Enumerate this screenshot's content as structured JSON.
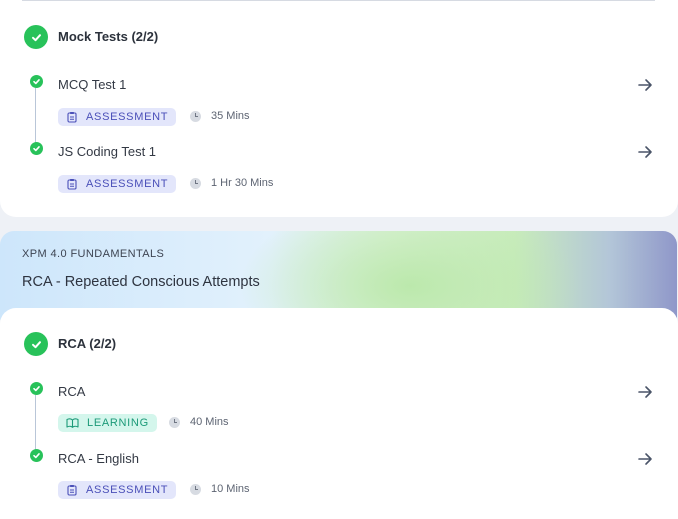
{
  "colors": {
    "success": "#28c25a",
    "assessment_badge_bg": "#e3e6fb",
    "assessment_badge_text": "#4a4fb8",
    "learning_badge_bg": "#d4f6ec",
    "learning_badge_text": "#1c9a78"
  },
  "mock_tests": {
    "title": "Mock Tests (2/2)",
    "items": [
      {
        "title": "MCQ Test 1",
        "badge": "ASSESSMENT",
        "badge_icon": "clipboard-icon",
        "duration": "35 Mins",
        "status": "completed"
      },
      {
        "title": "JS Coding Test 1",
        "badge": "ASSESSMENT",
        "badge_icon": "clipboard-icon",
        "duration": "1 Hr 30 Mins",
        "status": "completed"
      }
    ]
  },
  "banner": {
    "kicker": "XPM 4.0 FUNDAMENTALS",
    "title": "RCA - Repeated Conscious Attempts"
  },
  "rca": {
    "title": "RCA (2/2)",
    "items": [
      {
        "title": "RCA",
        "badge": "LEARNING",
        "badge_icon": "book-icon",
        "duration": "40 Mins",
        "status": "completed"
      },
      {
        "title": "RCA - English",
        "badge": "ASSESSMENT",
        "badge_icon": "clipboard-icon",
        "duration": "10 Mins",
        "status": "completed"
      }
    ]
  }
}
